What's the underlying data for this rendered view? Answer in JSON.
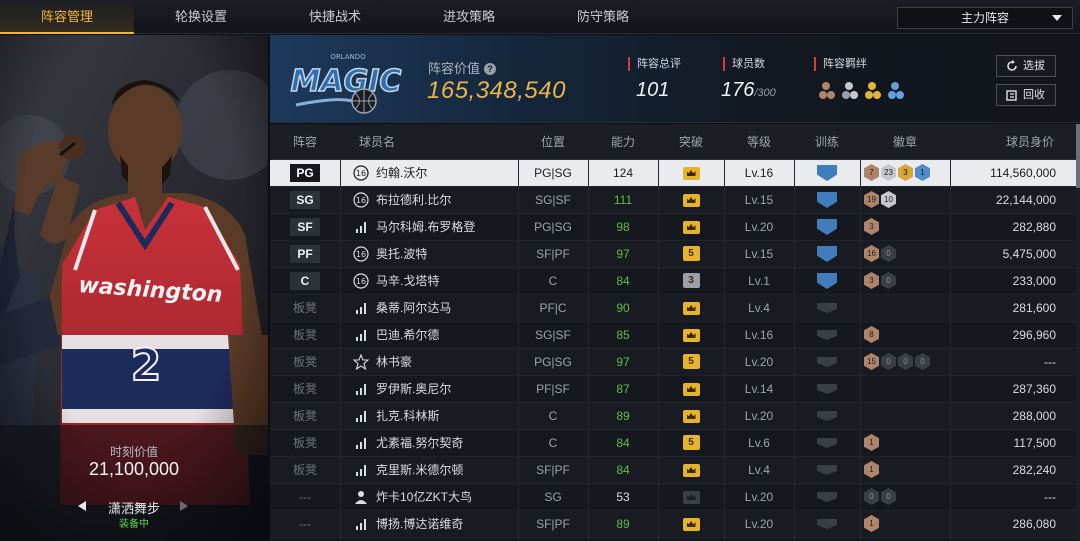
{
  "tabs": [
    {
      "label": "阵容管理",
      "active": true
    },
    {
      "label": "轮换设置",
      "active": false
    },
    {
      "label": "快捷战术",
      "active": false
    },
    {
      "label": "进攻策略",
      "active": false
    },
    {
      "label": "防守策略",
      "active": false
    }
  ],
  "lineup_select": {
    "value": "主力阵容"
  },
  "left_panel": {
    "moment_label": "时刻价值",
    "moment_value": "21,100,000",
    "skin_name": "潇洒舞步",
    "skin_status": "装备中",
    "jersey_text": "washington",
    "jersey_number": "2"
  },
  "team_header": {
    "logo_text": "MAGIC",
    "lineup_value_label": "阵容价值",
    "lineup_value": "165,348,540",
    "stats": [
      {
        "label": "阵容总评",
        "value": "101",
        "sub": ""
      },
      {
        "label": "球员数",
        "value": "176",
        "sub": "/300"
      },
      {
        "label": "阵容羁绊",
        "value": "",
        "sub": ""
      }
    ],
    "buttons": {
      "scout": "选拔",
      "recycle": "回收"
    }
  },
  "table": {
    "headers": [
      "阵容",
      "球员名",
      "位置",
      "能力",
      "突破",
      "等级",
      "训练",
      "徽章",
      "球员身价"
    ],
    "rows": [
      {
        "slot": "PG",
        "icon": "num16",
        "name": "约翰.沃尔",
        "pos": "PG|SG",
        "ability": "124",
        "ability_green": false,
        "crown": "gold",
        "crown_num": "",
        "level": "Lv.16",
        "train": "blue",
        "badges": [
          [
            "bronze",
            "7"
          ],
          [
            "silver",
            "23"
          ],
          [
            "gold",
            "3"
          ],
          [
            "blue",
            "1"
          ]
        ],
        "value": "114,560,000",
        "selected": true
      },
      {
        "slot": "SG",
        "icon": "num16",
        "name": "布拉德利.比尔",
        "pos": "SG|SF",
        "ability": "111",
        "ability_green": true,
        "crown": "gold",
        "crown_num": "",
        "level": "Lv.15",
        "train": "blue",
        "badges": [
          [
            "bronze",
            "19"
          ],
          [
            "silver",
            "10"
          ]
        ],
        "value": "22,144,000",
        "selected": false
      },
      {
        "slot": "SF",
        "icon": "bars",
        "name": "马尔科姆.布罗格登",
        "pos": "PG|SG",
        "ability": "98",
        "ability_green": true,
        "crown": "gold",
        "crown_num": "",
        "level": "Lv.20",
        "train": "blue",
        "badges": [
          [
            "bronze",
            "3"
          ]
        ],
        "value": "282,880",
        "selected": false
      },
      {
        "slot": "PF",
        "icon": "num16",
        "name": "奥托.波特",
        "pos": "SF|PF",
        "ability": "97",
        "ability_green": true,
        "crown": "gold",
        "crown_num": "5",
        "level": "Lv.15",
        "train": "blue",
        "badges": [
          [
            "bronze",
            "16"
          ],
          [
            "dark",
            "0"
          ]
        ],
        "value": "5,475,000",
        "selected": false
      },
      {
        "slot": "C",
        "icon": "num16",
        "name": "马辛.戈塔特",
        "pos": "C",
        "ability": "84",
        "ability_green": true,
        "crown": "silver",
        "crown_num": "3",
        "level": "Lv.1",
        "train": "blue",
        "badges": [
          [
            "bronze",
            "3"
          ],
          [
            "dark",
            "0"
          ]
        ],
        "value": "233,000",
        "selected": false
      },
      {
        "slot": "板凳",
        "icon": "bars",
        "name": "桑蒂.阿尔达马",
        "pos": "PF|C",
        "ability": "90",
        "ability_green": true,
        "crown": "gold",
        "crown_num": "",
        "level": "Lv.4",
        "train": "grey",
        "badges": [],
        "value": "281,600",
        "selected": false
      },
      {
        "slot": "板凳",
        "icon": "bars",
        "name": "巴迪.希尔德",
        "pos": "SG|SF",
        "ability": "85",
        "ability_green": true,
        "crown": "gold",
        "crown_num": "",
        "level": "Lv.16",
        "train": "grey",
        "badges": [
          [
            "bronze",
            "8"
          ]
        ],
        "value": "296,960",
        "selected": false
      },
      {
        "slot": "板凳",
        "icon": "star",
        "name": "林书豪",
        "pos": "PG|SG",
        "ability": "97",
        "ability_green": true,
        "crown": "gold",
        "crown_num": "5",
        "level": "Lv.20",
        "train": "grey",
        "badges": [
          [
            "bronze",
            "15"
          ],
          [
            "dark",
            "0"
          ],
          [
            "dark",
            "0"
          ],
          [
            "dark",
            "0"
          ]
        ],
        "value": "---",
        "selected": false
      },
      {
        "slot": "板凳",
        "icon": "bars",
        "name": "罗伊斯.奥尼尔",
        "pos": "PF|SF",
        "ability": "87",
        "ability_green": true,
        "crown": "gold",
        "crown_num": "",
        "level": "Lv.14",
        "train": "grey",
        "badges": [],
        "value": "287,360",
        "selected": false
      },
      {
        "slot": "板凳",
        "icon": "bars",
        "name": "扎克.科林斯",
        "pos": "C",
        "ability": "89",
        "ability_green": true,
        "crown": "gold",
        "crown_num": "",
        "level": "Lv.20",
        "train": "grey",
        "badges": [],
        "value": "288,000",
        "selected": false
      },
      {
        "slot": "板凳",
        "icon": "bars",
        "name": "尤素福.努尔契奇",
        "pos": "C",
        "ability": "84",
        "ability_green": true,
        "crown": "gold",
        "crown_num": "5",
        "level": "Lv.6",
        "train": "grey",
        "badges": [
          [
            "bronze",
            "1"
          ]
        ],
        "value": "117,500",
        "selected": false
      },
      {
        "slot": "板凳",
        "icon": "bars",
        "name": "克里斯.米德尔顿",
        "pos": "SF|PF",
        "ability": "84",
        "ability_green": true,
        "crown": "gold",
        "crown_num": "",
        "level": "Lv.4",
        "train": "grey",
        "badges": [
          [
            "bronze",
            "1"
          ]
        ],
        "value": "282,240",
        "selected": false
      },
      {
        "slot": "---",
        "icon": "person",
        "name": "炸卡10亿ZKT大鸟",
        "pos": "SG",
        "ability": "53",
        "ability_green": false,
        "crown": "grey",
        "crown_num": "",
        "level": "Lv.20",
        "train": "grey",
        "badges": [
          [
            "dark",
            "0"
          ],
          [
            "dark",
            "0"
          ]
        ],
        "value": "---",
        "selected": false
      },
      {
        "slot": "---",
        "icon": "bars",
        "name": "博扬.博达诺维奇",
        "pos": "SF|PF",
        "ability": "89",
        "ability_green": true,
        "crown": "gold",
        "crown_num": "",
        "level": "Lv.20",
        "train": "grey",
        "badges": [
          [
            "bronze",
            "1"
          ]
        ],
        "value": "286,080",
        "selected": false
      }
    ]
  },
  "colors": {
    "accent": "#f0b43a",
    "value_gold": "#e9b54a",
    "green": "#5dbf3f",
    "stat_marker": "#d63a3a"
  }
}
